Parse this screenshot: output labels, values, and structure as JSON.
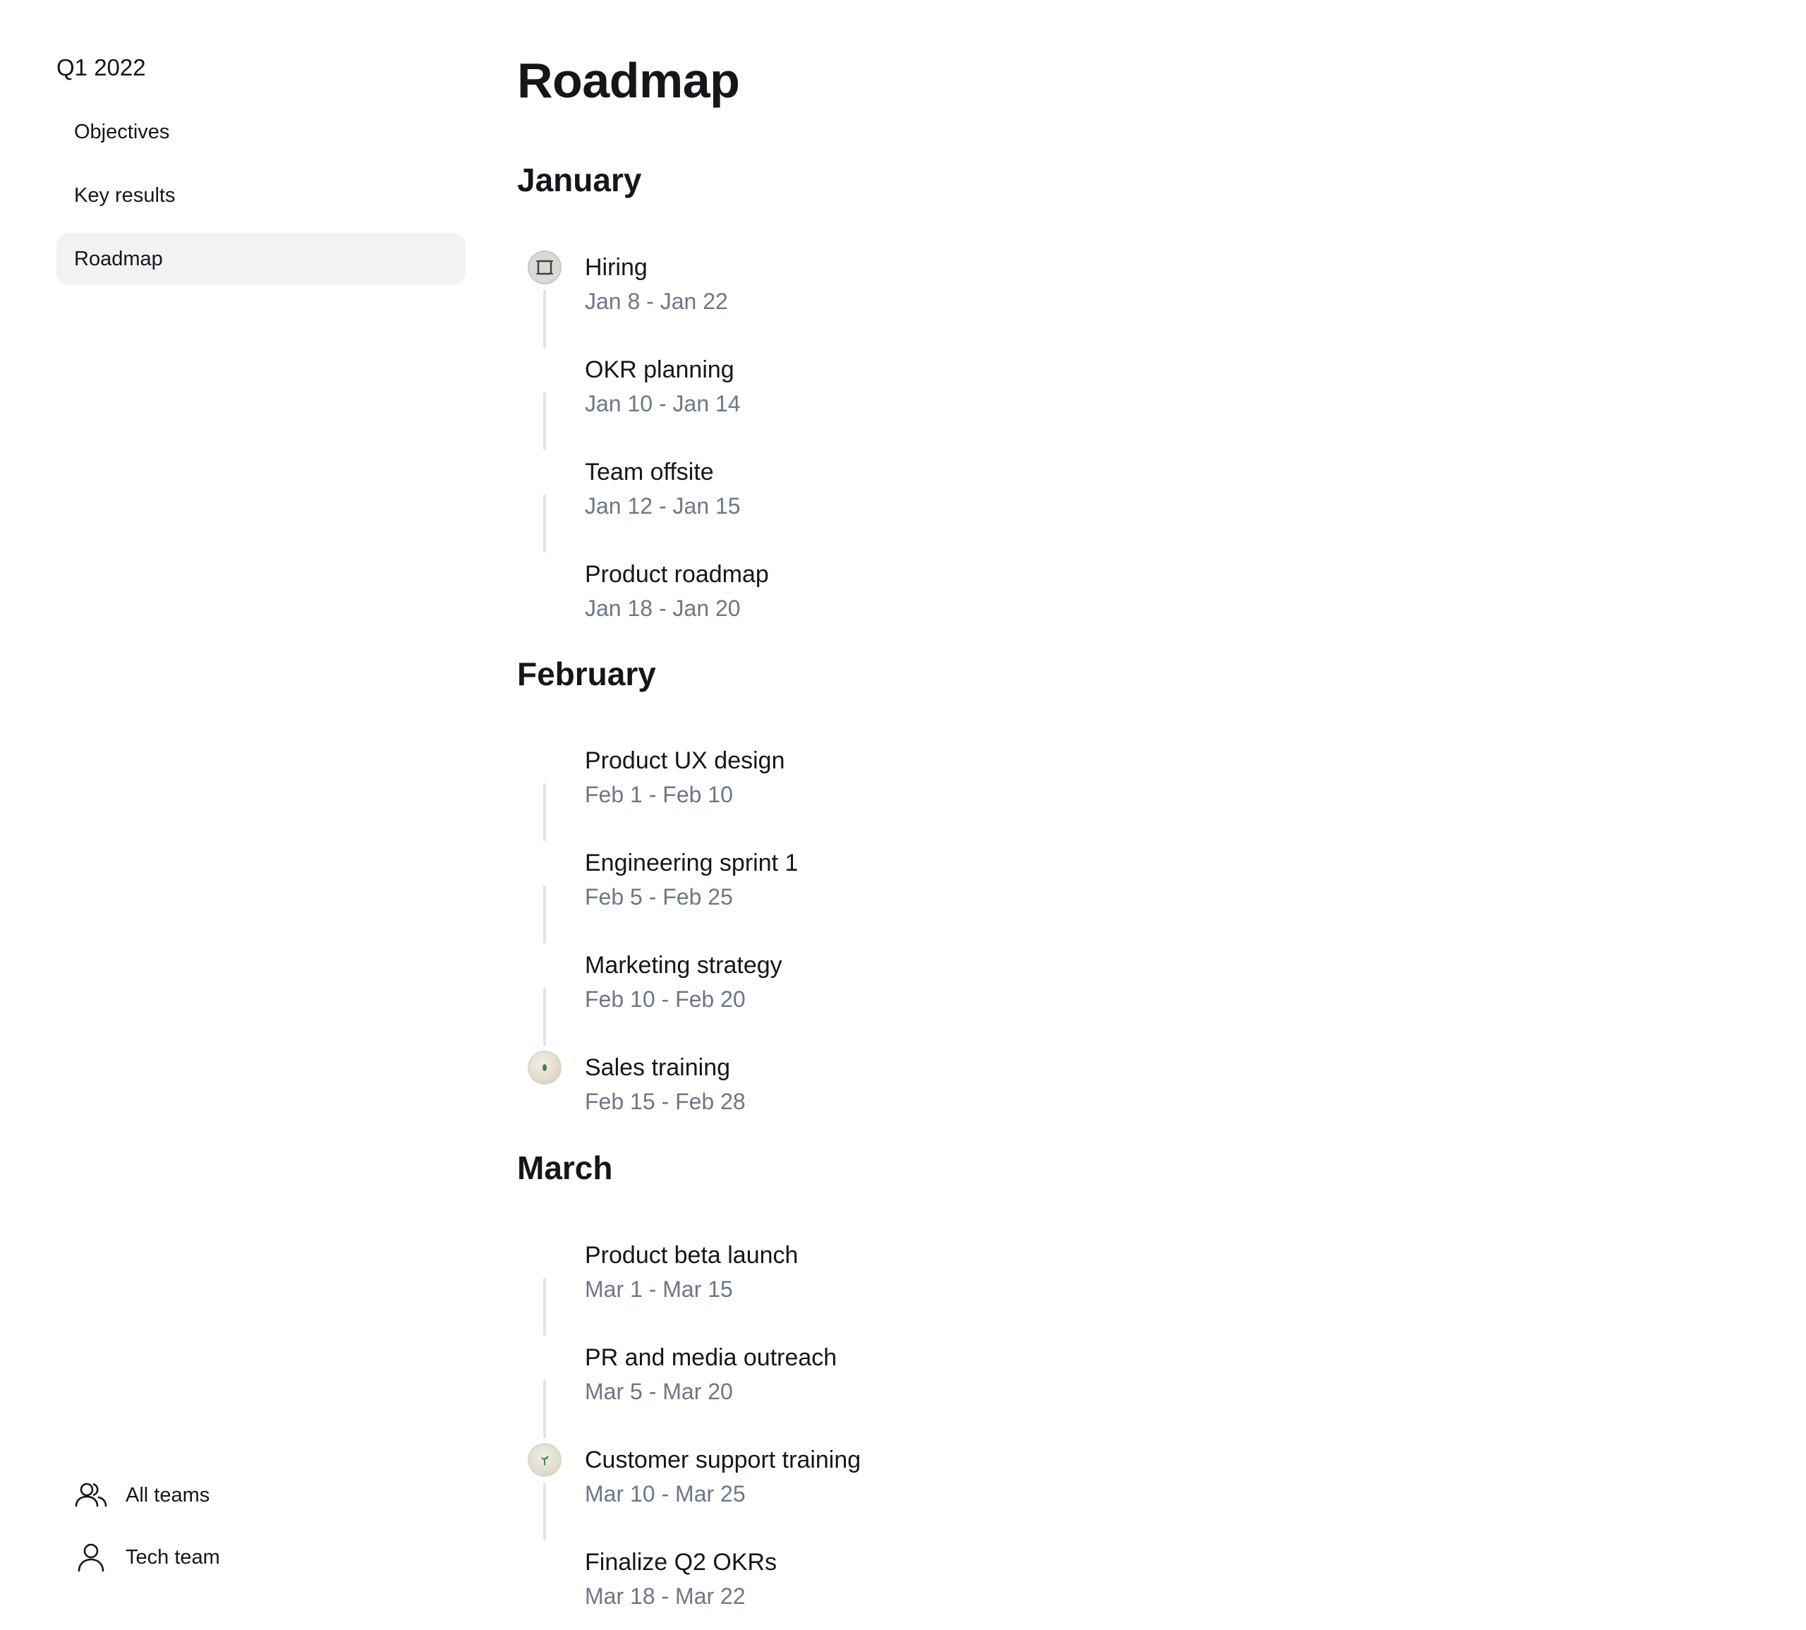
{
  "sidebar": {
    "quarter": "Q1 2022",
    "nav": [
      {
        "label": "Objectives",
        "active": false
      },
      {
        "label": "Key results",
        "active": false
      },
      {
        "label": "Roadmap",
        "active": true
      }
    ],
    "teams": [
      {
        "label": "All teams",
        "icon": "users-icon"
      },
      {
        "label": "Tech team",
        "icon": "user-icon"
      }
    ]
  },
  "main": {
    "title": "Roadmap",
    "months": [
      {
        "name": "January",
        "events": [
          {
            "name": "Hiring",
            "dates": "Jan 8 - Jan 22",
            "icon": "hiring-avatar-icon"
          },
          {
            "name": "OKR planning",
            "dates": "Jan 10 - Jan 14"
          },
          {
            "name": "Team offsite",
            "dates": "Jan 12 - Jan 15"
          },
          {
            "name": "Product roadmap",
            "dates": "Jan 18 - Jan 20"
          }
        ]
      },
      {
        "name": "February",
        "events": [
          {
            "name": "Product UX design",
            "dates": "Feb 1 - Feb 10"
          },
          {
            "name": "Engineering sprint 1",
            "dates": "Feb 5 - Feb 25"
          },
          {
            "name": "Marketing strategy",
            "dates": "Feb 10 - Feb 20"
          },
          {
            "name": "Sales training",
            "dates": "Feb 15 - Feb 28",
            "icon": "leaf-avatar-icon"
          }
        ]
      },
      {
        "name": "March",
        "events": [
          {
            "name": "Product beta launch",
            "dates": "Mar 1 - Mar 15"
          },
          {
            "name": "PR and media outreach",
            "dates": "Mar 5 - Mar 20"
          },
          {
            "name": "Customer support training",
            "dates": "Mar 10 - Mar 25",
            "icon": "sprout-avatar-icon"
          },
          {
            "name": "Finalize Q2 OKRs",
            "dates": "Mar 18 - Mar 22"
          }
        ]
      }
    ]
  },
  "colors": {
    "text": "#14171a",
    "muted": "#6c7787",
    "active_nav_bg": "#f1f2f4",
    "connector": "#e2e3e6"
  }
}
